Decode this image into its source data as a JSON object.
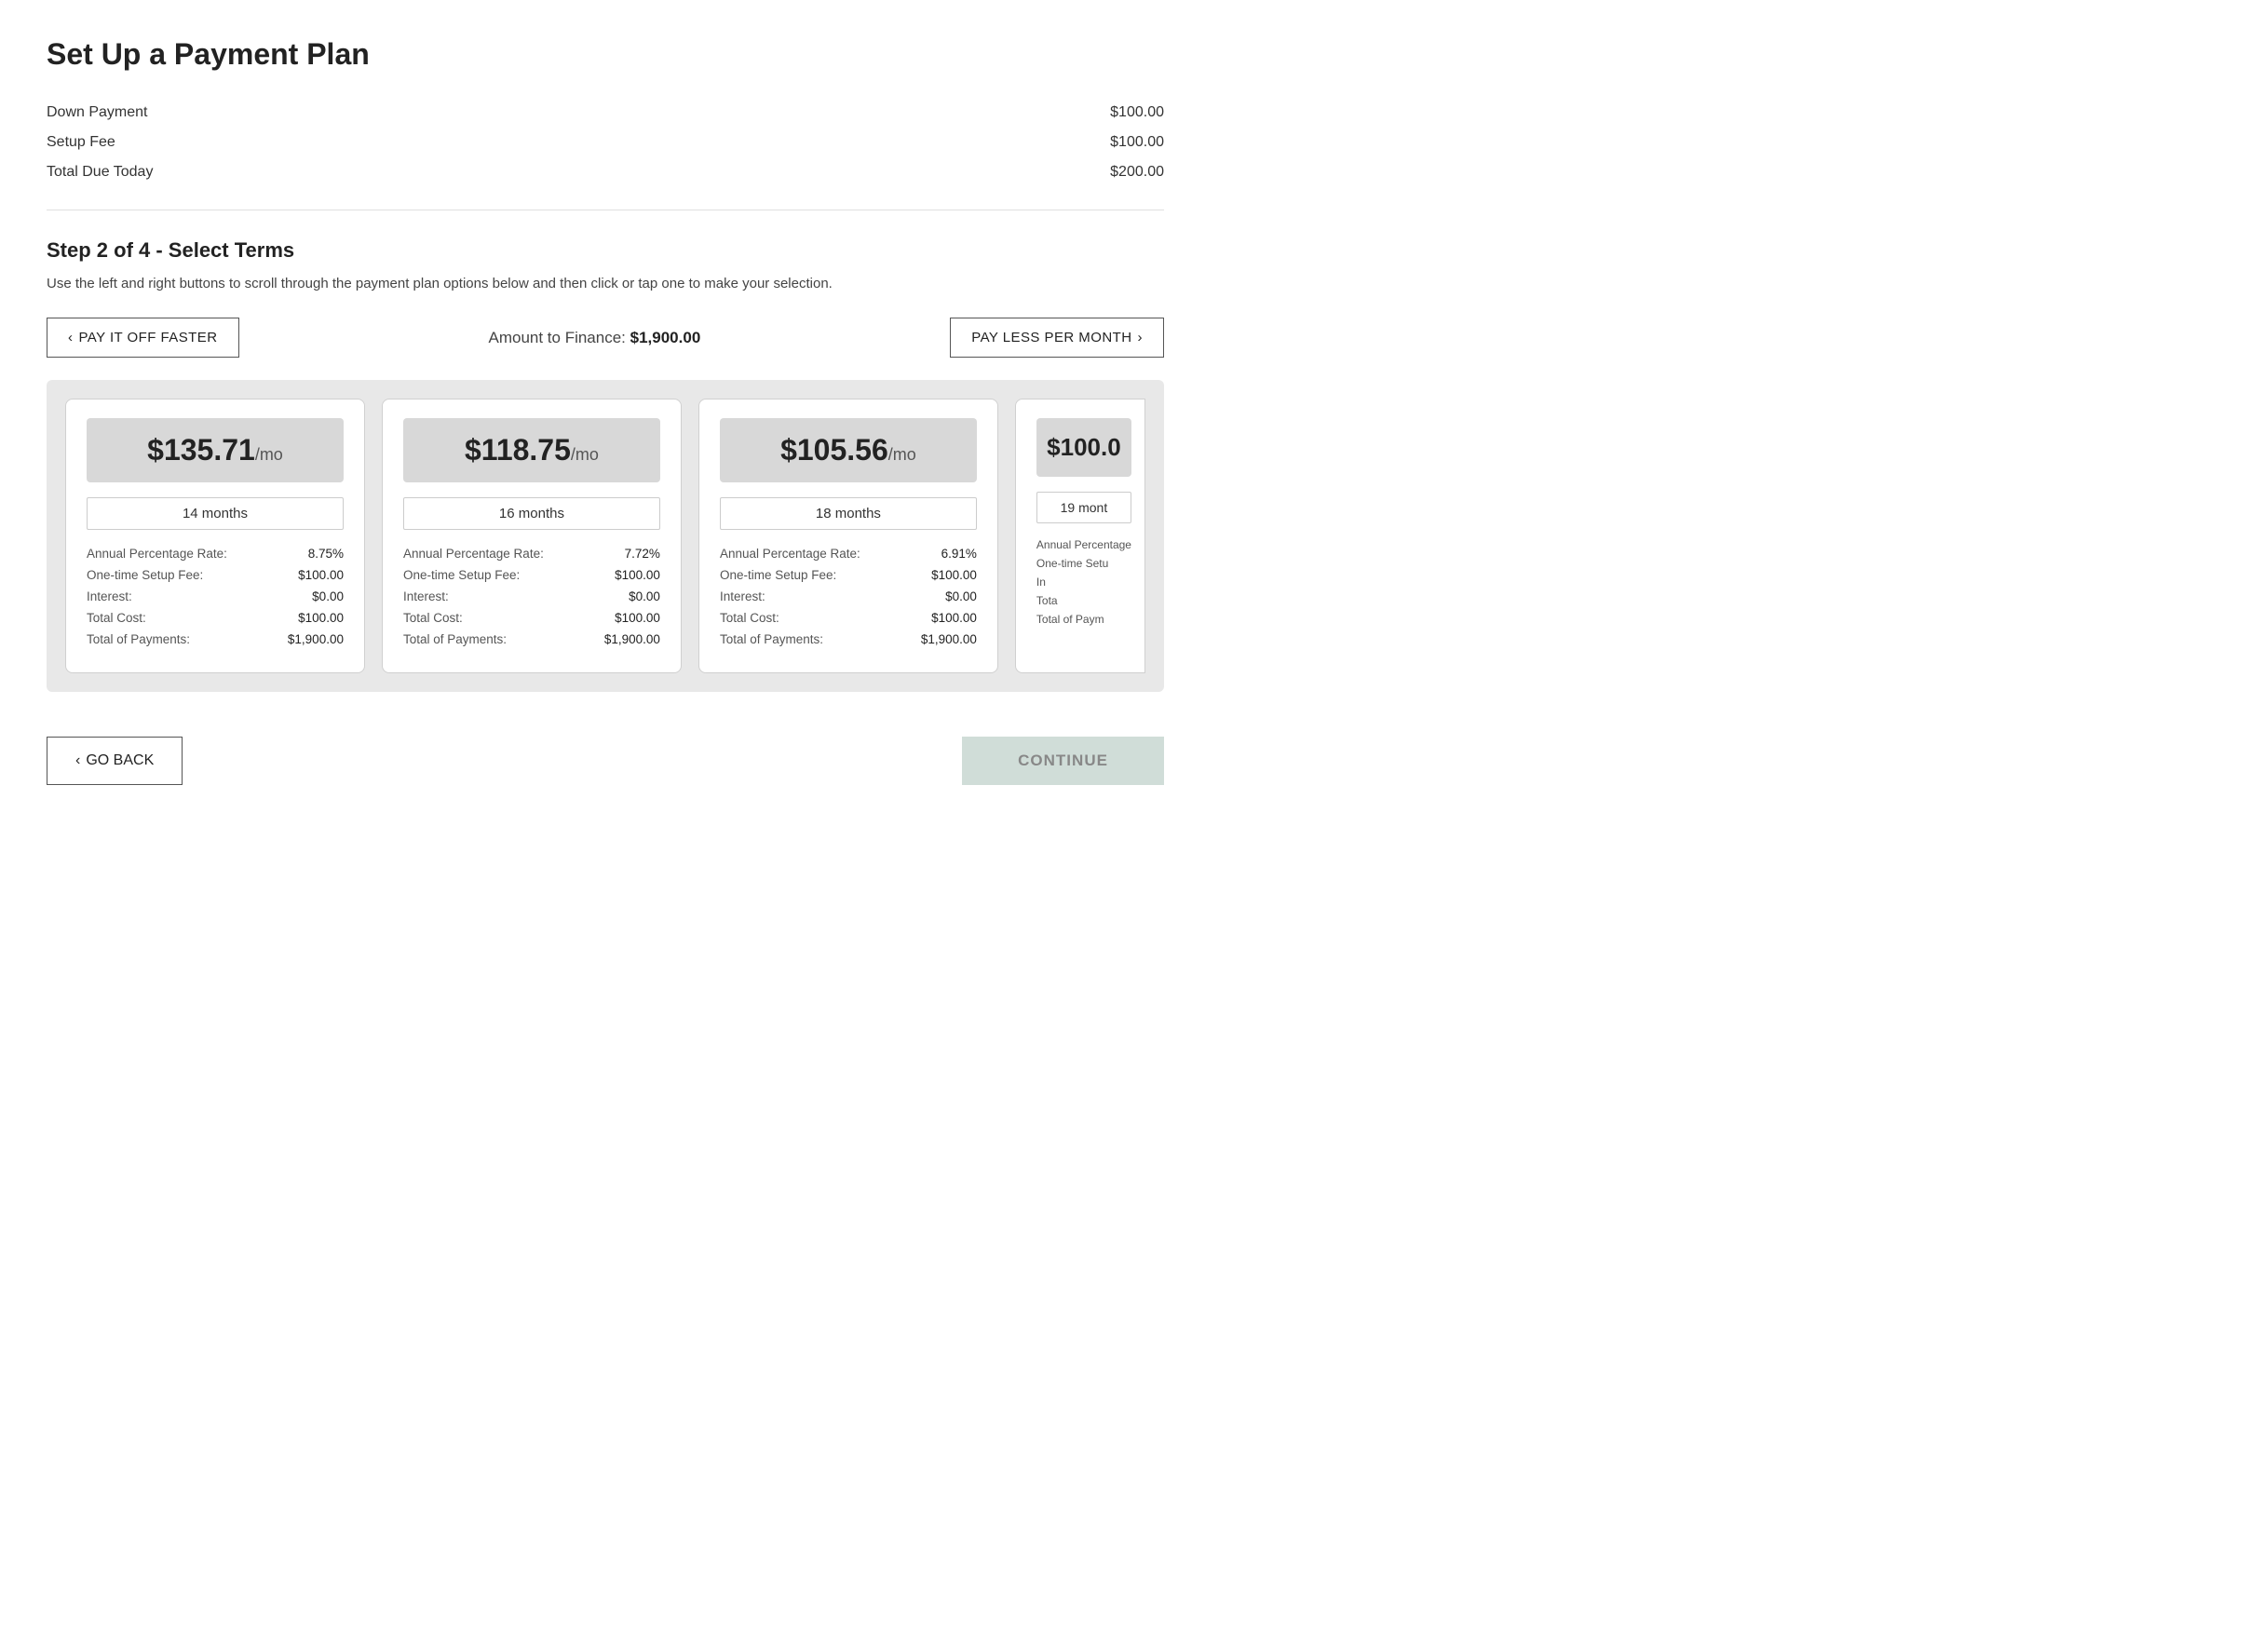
{
  "page": {
    "title": "Set Up a Payment Plan",
    "summary": {
      "rows": [
        {
          "label": "Down Payment",
          "value": "$100.00"
        },
        {
          "label": "Setup Fee",
          "value": "$100.00"
        },
        {
          "label": "Total Due Today",
          "value": "$200.00"
        }
      ]
    },
    "step_title": "Step 2 of 4 - Select Terms",
    "instruction": "Use the left and right buttons to scroll through the payment plan options below and then click or tap one to make your selection.",
    "nav": {
      "left_label": "PAY IT OFF FASTER",
      "right_label": "PAY LESS PER MONTH",
      "amount_label": "Amount to Finance:",
      "amount_value": "$1,900.00"
    },
    "plans": [
      {
        "monthly": "$135.71",
        "unit": "/mo",
        "months": "14 months",
        "apr_label": "Annual Percentage Rate:",
        "apr_value": "8.75%",
        "setup_label": "One-time Setup Fee:",
        "setup_value": "$100.00",
        "interest_label": "Interest:",
        "interest_value": "$0.00",
        "total_cost_label": "Total Cost:",
        "total_cost_value": "$100.00",
        "total_payments_label": "Total of Payments:",
        "total_payments_value": "$1,900.00"
      },
      {
        "monthly": "$118.75",
        "unit": "/mo",
        "months": "16 months",
        "apr_label": "Annual Percentage Rate:",
        "apr_value": "7.72%",
        "setup_label": "One-time Setup Fee:",
        "setup_value": "$100.00",
        "interest_label": "Interest:",
        "interest_value": "$0.00",
        "total_cost_label": "Total Cost:",
        "total_cost_value": "$100.00",
        "total_payments_label": "Total of Payments:",
        "total_payments_value": "$1,900.00"
      },
      {
        "monthly": "$105.56",
        "unit": "/mo",
        "months": "18 months",
        "apr_label": "Annual Percentage Rate:",
        "apr_value": "6.91%",
        "setup_label": "One-time Setup Fee:",
        "setup_value": "$100.00",
        "interest_label": "Interest:",
        "interest_value": "$0.00",
        "total_cost_label": "Total Cost:",
        "total_cost_value": "$100.00",
        "total_payments_label": "Total of Payments:",
        "total_payments_value": "$1,900.00"
      }
    ],
    "partial_plan": {
      "monthly": "$100.0",
      "months": "19 mont",
      "apr_label": "Annual Percentage",
      "setup_label": "One-time Setu",
      "interest_label": "In",
      "total_label": "Tota",
      "payments_label": "Total of Paym"
    },
    "footer": {
      "go_back": "GO BACK",
      "continue": "CONTINUE"
    }
  }
}
